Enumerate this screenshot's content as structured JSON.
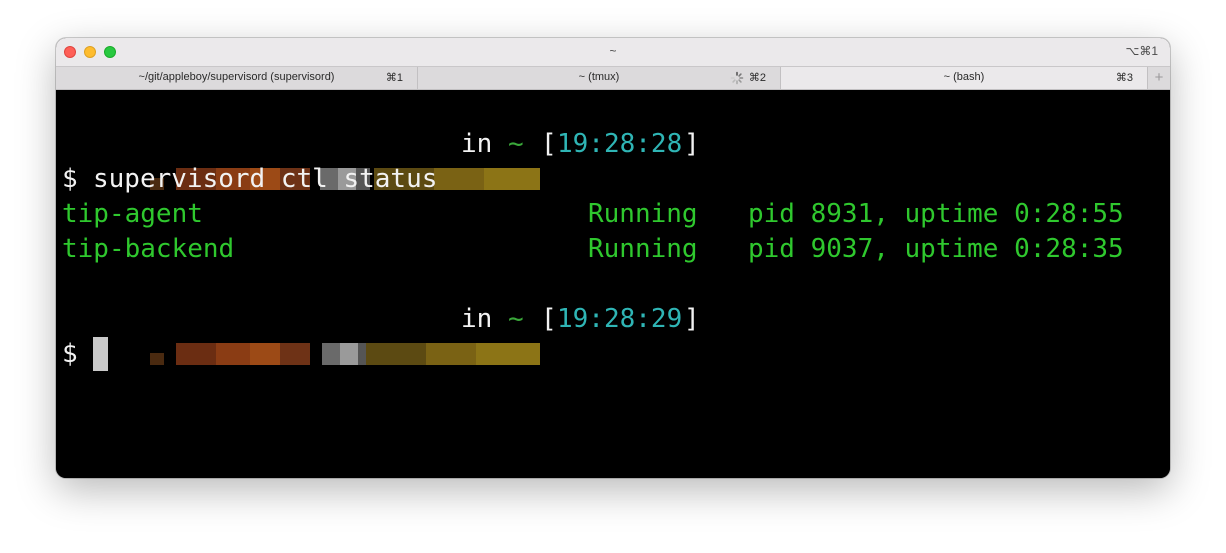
{
  "window": {
    "title": "~",
    "shortcut": "⌥⌘1"
  },
  "tabs": [
    {
      "label": "~/git/appleboy/supervisord (supervisord)",
      "key": "⌘1",
      "active": false
    },
    {
      "label": "~ (tmux)",
      "key": "⌘2",
      "active": false,
      "busy": true
    },
    {
      "label": "~ (bash)",
      "key": "⌘3",
      "active": true
    }
  ],
  "tab_add_label": "+",
  "terminal": {
    "prompt1": {
      "in": "in",
      "tilde": "~",
      "open": "[",
      "time": "19:28:28",
      "close": "]"
    },
    "command_line": {
      "symbol": "$",
      "command": "supervisord ctl status"
    },
    "processes": [
      {
        "name": "tip-agent",
        "state": "Running",
        "info": "pid 8931, uptime 0:28:55"
      },
      {
        "name": "tip-backend",
        "state": "Running",
        "info": "pid 9037, uptime 0:28:35"
      }
    ],
    "prompt2": {
      "in": "in",
      "tilde": "~",
      "open": "[",
      "time": "19:28:29",
      "close": "]"
    },
    "input_line": {
      "symbol": "$"
    }
  },
  "colors": {
    "green": "#2fc82e",
    "cyan": "#2fb5b5",
    "background": "#000000"
  }
}
